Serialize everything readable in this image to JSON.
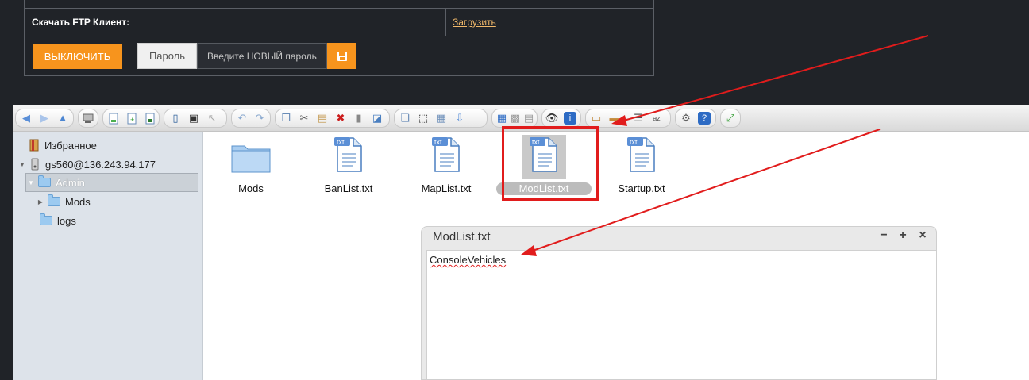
{
  "panel": {
    "ftp_label": "Скачать FTP Клиент:",
    "download_link": "Загрузить",
    "off_button": "ВЫКЛЮЧИТЬ",
    "password_label": "Пароль",
    "password_placeholder": "Введите НОВЫЙ пароль",
    "save_icon": "floppy-icon",
    "accent": "#f7941d"
  },
  "file_manager": {
    "toolbar_icons": [
      "back-icon",
      "forward-icon",
      "up-icon",
      "server-icon",
      "new-folder-icon",
      "new-file-icon",
      "save-icon",
      "copy-icon",
      "save-all-icon",
      "select-icon",
      "undo-icon",
      "redo-icon",
      "duplicate-icon",
      "cut-icon",
      "paste-icon",
      "delete-icon",
      "rename-icon",
      "edit-icon",
      "info-icon",
      "extract-icon",
      "archive-icon",
      "download-icon",
      "view-icons-icon",
      "view-small-icon",
      "view-list-icon",
      "preview-icon",
      "properties-icon",
      "sort-icon",
      "sort-name-icon",
      "sort-size-icon",
      "sort-az-icon",
      "settings-icon",
      "help-icon",
      "fullscreen-icon"
    ],
    "tree": {
      "favorites": "Избранное",
      "server": "gs560@136.243.94.177",
      "admin": "Admin",
      "mods": "Mods",
      "logs": "logs"
    },
    "files": [
      {
        "name": "Mods",
        "type": "folder"
      },
      {
        "name": "BanList.txt",
        "type": "txt"
      },
      {
        "name": "MapList.txt",
        "type": "txt"
      },
      {
        "name": "ModList.txt",
        "type": "txt"
      },
      {
        "name": "Startup.txt",
        "type": "txt"
      }
    ],
    "file_badge": "txt",
    "editor": {
      "title": "ModList.txt",
      "minimize": "−",
      "maximize": "+",
      "close": "×",
      "content": "ConsoleVehicles"
    }
  },
  "colors": {
    "annotation_red": "#e11c1c",
    "background": "#202328"
  }
}
